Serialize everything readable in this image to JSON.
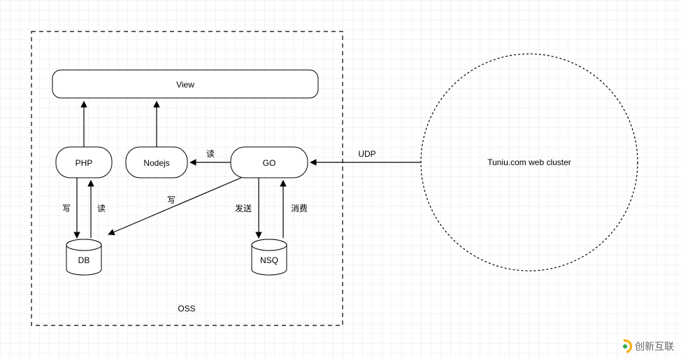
{
  "diagram": {
    "container_label": "OSS",
    "view_label": "View",
    "php_label": "PHP",
    "nodejs_label": "Nodejs",
    "go_label": "GO",
    "db_label": "DB",
    "nsq_label": "NSQ",
    "cluster_label": "Tuniu.com web cluster",
    "edge_udp": "UDP",
    "edge_read_go_nodejs": "读",
    "edge_write_php_db": "写",
    "edge_read_php_db": "读",
    "edge_write_go_db": "写",
    "edge_send_go_nsq": "发送",
    "edge_consume_nsq_go": "消费"
  },
  "watermark": {
    "text": "创新互联"
  },
  "chart_data": {
    "type": "diagram",
    "title": "OSS architecture diagram",
    "nodes": [
      {
        "id": "oss",
        "label": "OSS",
        "kind": "container"
      },
      {
        "id": "view",
        "label": "View",
        "kind": "rounded-rect"
      },
      {
        "id": "php",
        "label": "PHP",
        "kind": "rounded-rect"
      },
      {
        "id": "nodejs",
        "label": "Nodejs",
        "kind": "rounded-rect"
      },
      {
        "id": "go",
        "label": "GO",
        "kind": "rounded-rect"
      },
      {
        "id": "db",
        "label": "DB",
        "kind": "cylinder"
      },
      {
        "id": "nsq",
        "label": "NSQ",
        "kind": "cylinder"
      },
      {
        "id": "cluster",
        "label": "Tuniu.com web cluster",
        "kind": "dashed-circle"
      }
    ],
    "edges": [
      {
        "from": "php",
        "to": "view",
        "label": ""
      },
      {
        "from": "nodejs",
        "to": "view",
        "label": ""
      },
      {
        "from": "go",
        "to": "nodejs",
        "label": "读"
      },
      {
        "from": "cluster",
        "to": "go",
        "label": "UDP"
      },
      {
        "from": "php",
        "to": "db",
        "label": "写"
      },
      {
        "from": "db",
        "to": "php",
        "label": "读"
      },
      {
        "from": "go",
        "to": "db",
        "label": "写"
      },
      {
        "from": "go",
        "to": "nsq",
        "label": "发送"
      },
      {
        "from": "nsq",
        "to": "go",
        "label": "消费"
      }
    ]
  }
}
